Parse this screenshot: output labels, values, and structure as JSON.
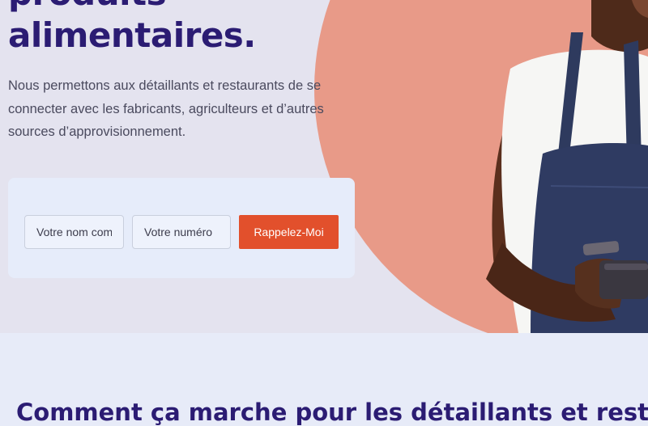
{
  "hero": {
    "headline_line1": "produits",
    "headline_line2": "alimentaires.",
    "lead": "Nous permettons aux détaillants et restaurants de se connecter avec les fabricants, agriculteurs et d’autres sources d’approvisionnement."
  },
  "callback_form": {
    "name_placeholder": "Votre nom complet",
    "phone_placeholder": "Votre numéro",
    "submit_label": "Rappelez-Moi"
  },
  "how_it_works": {
    "title": "Comment ça marche pour les détaillants et restaurants"
  },
  "colors": {
    "brand_navy": "#2b1c73",
    "accent_orange": "#e2502c",
    "hero_circle": "#e89a88",
    "hero_bg": "#e4e3ef",
    "section_bg": "#e7ebf8"
  }
}
